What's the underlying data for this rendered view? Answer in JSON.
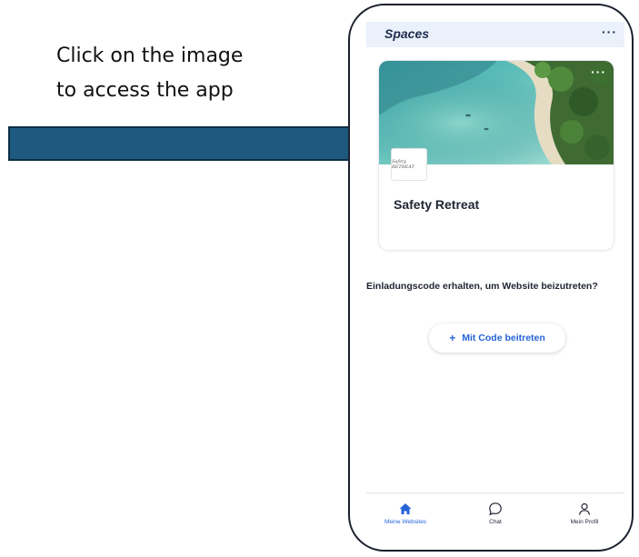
{
  "annotation": {
    "line1": "Click on the image",
    "line2": "to access the app",
    "arrow_color": "#1e5a80"
  },
  "header": {
    "title": "Spaces",
    "more": "···"
  },
  "card": {
    "more": "···",
    "logo_text": "Safety RETREAT",
    "title": "Safety Retreat"
  },
  "invite": {
    "text": "Einladungscode erhalten, um Website beizutreten?",
    "button_plus": "+",
    "button_label": "Mit Code beitreten"
  },
  "bottom_nav": {
    "items": [
      {
        "label": "Meine Websites",
        "icon": "home-icon",
        "active": true
      },
      {
        "label": "Chat",
        "icon": "chat-bubble-icon",
        "active": false
      },
      {
        "label": "Mein Profil",
        "icon": "user-icon",
        "active": false
      }
    ]
  },
  "colors": {
    "accent": "#2563d6",
    "header_bg": "#eaf1fb"
  }
}
